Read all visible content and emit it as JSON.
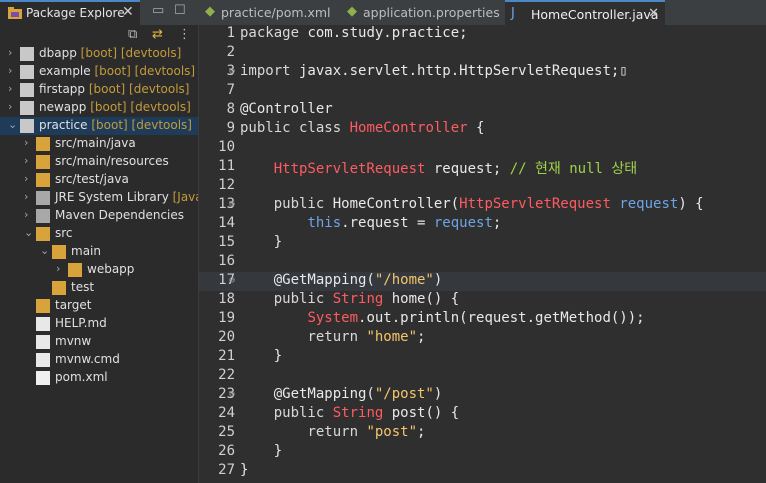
{
  "explorer": {
    "tab_label": "Package Explore",
    "close": "✕",
    "items": [
      {
        "label": "dbapp",
        "decor": " [boot] [devtools]",
        "level": 0,
        "twisty": "›",
        "icon": "project-icon"
      },
      {
        "label": "example",
        "decor": " [boot] [devtools]",
        "level": 0,
        "twisty": "›",
        "icon": "project-icon"
      },
      {
        "label": "firstapp",
        "decor": " [boot] [devtools]",
        "level": 0,
        "twisty": "›",
        "icon": "project-icon"
      },
      {
        "label": "newapp",
        "decor": " [boot] [devtools]",
        "level": 0,
        "twisty": "›",
        "icon": "project-icon"
      },
      {
        "label": "practice",
        "decor": " [boot] [devtools]",
        "level": 0,
        "twisty": "⌄",
        "icon": "project-icon",
        "selected": true
      },
      {
        "label": "src/main/java",
        "decor": "",
        "level": 1,
        "twisty": "›",
        "icon": "source-folder-icon"
      },
      {
        "label": "src/main/resources",
        "decor": "",
        "level": 1,
        "twisty": "›",
        "icon": "source-folder-icon"
      },
      {
        "label": "src/test/java",
        "decor": "",
        "level": 1,
        "twisty": "›",
        "icon": "source-folder-icon"
      },
      {
        "label": "JRE System Library",
        "decor": " [JavaS",
        "level": 1,
        "twisty": "›",
        "icon": "library-icon"
      },
      {
        "label": "Maven Dependencies",
        "decor": "",
        "level": 1,
        "twisty": "›",
        "icon": "library-icon"
      },
      {
        "label": "src",
        "decor": "",
        "level": 1,
        "twisty": "⌄",
        "icon": "folder-icon"
      },
      {
        "label": "main",
        "decor": "",
        "level": 2,
        "twisty": "⌄",
        "icon": "folder-icon"
      },
      {
        "label": "webapp",
        "decor": "",
        "level": 3,
        "twisty": "›",
        "icon": "folder-icon"
      },
      {
        "label": "test",
        "decor": "",
        "level": 2,
        "twisty": "",
        "icon": "folder-icon"
      },
      {
        "label": "target",
        "decor": "",
        "level": 1,
        "twisty": "",
        "icon": "folder-icon"
      },
      {
        "label": "HELP.md",
        "decor": "",
        "level": 1,
        "twisty": "",
        "icon": "file-icon"
      },
      {
        "label": "mvnw",
        "decor": "",
        "level": 1,
        "twisty": "",
        "icon": "file-icon"
      },
      {
        "label": "mvnw.cmd",
        "decor": "",
        "level": 1,
        "twisty": "",
        "icon": "file-icon"
      },
      {
        "label": "pom.xml",
        "decor": "",
        "level": 1,
        "twisty": "",
        "icon": "xml-file-icon"
      }
    ]
  },
  "editor": {
    "tabs": [
      {
        "label": "practice/pom.xml",
        "active": false
      },
      {
        "label": "application.properties",
        "active": false
      },
      {
        "label": "HomeController.java",
        "active": true
      }
    ],
    "close": "✕",
    "lines": [
      {
        "n": "1",
        "html": "<span class='kw2'>package</span> com.study.practice;"
      },
      {
        "n": "2",
        "html": ""
      },
      {
        "n": "3",
        "fold": true,
        "html": "<span class='kw2'>import</span> javax.servlet.http.HttpServletRequest;▯"
      },
      {
        "n": "7",
        "html": ""
      },
      {
        "n": "8",
        "html": "@Controller"
      },
      {
        "n": "9",
        "html": "<span class='kw2'>public class</span> <span class='type'>HomeController</span> {"
      },
      {
        "n": "10",
        "html": ""
      },
      {
        "n": "11",
        "html": "    <span class='type'>HttpServletRequest</span> request; <span class='cmt'>// 현재 null 상태</span>"
      },
      {
        "n": "12",
        "html": ""
      },
      {
        "n": "13",
        "fold": true,
        "html": "    <span class='kw2'>public</span> HomeController(<span class='type'>HttpServletRequest</span> <span class='field'>request</span>) {"
      },
      {
        "n": "14",
        "html": "        <span class='field'>this</span>.request = <span class='field'>request</span>;"
      },
      {
        "n": "15",
        "html": "    }"
      },
      {
        "n": "16",
        "html": ""
      },
      {
        "n": "17",
        "fold": true,
        "hl": true,
        "html": "    @GetMapping(<span class='str'>\"/home\"</span>)"
      },
      {
        "n": "18",
        "html": "    <span class='kw2'>public</span> <span class='type'>String</span> home() {"
      },
      {
        "n": "19",
        "html": "        <span class='type'>System</span>.out.println(request.getMethod());"
      },
      {
        "n": "20",
        "html": "        <span class='kw2'>return</span> <span class='str'>\"home\"</span>;"
      },
      {
        "n": "21",
        "html": "    }"
      },
      {
        "n": "22",
        "html": ""
      },
      {
        "n": "23",
        "fold": true,
        "html": "    @GetMapping(<span class='str'>\"/post\"</span>)"
      },
      {
        "n": "24",
        "html": "    <span class='kw2'>public</span> <span class='type'>String</span> post() {"
      },
      {
        "n": "25",
        "html": "        <span class='kw2'>return</span> <span class='str'>\"post\"</span>;"
      },
      {
        "n": "26",
        "html": "    }"
      },
      {
        "n": "27",
        "html": "}"
      }
    ]
  }
}
